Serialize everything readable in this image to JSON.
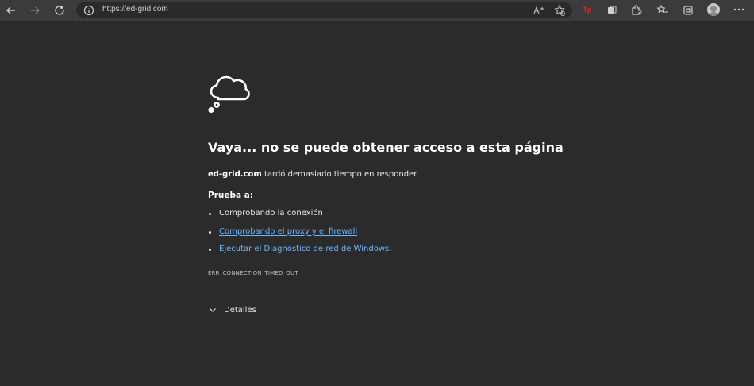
{
  "browser": {
    "url": "https://ed-grid.com",
    "toolbar_icons": [
      "back-icon",
      "forward-icon",
      "refresh-icon",
      "info-icon",
      "read-aloud-icon",
      "favorite-add-icon",
      "extension-tp-icon",
      "collections-icon",
      "extensions-icon",
      "favorites-icon",
      "screenshot-icon",
      "profile-icon",
      "more-menu-icon"
    ],
    "extension_badge": "Tp"
  },
  "error_page": {
    "title": "Vaya... no se puede obtener acceso a esta página",
    "host": "ed-grid.com",
    "desc_rest": " tardó demasiado tiempo en responder",
    "try_label": "Prueba a:",
    "suggestions": [
      {
        "text": "Comprobando la conexión",
        "is_link": false
      },
      {
        "text": "Comprobando el proxy y el firewall",
        "is_link": true
      },
      {
        "text": "Ejecutar el Diagnóstico de red de Windows",
        "is_link": true,
        "suffix": "."
      }
    ],
    "error_code": "ERR_CONNECTION_TIMED_OUT",
    "details_label": "Detalles"
  },
  "colors": {
    "background": "#2b2b2b",
    "toolbar": "#3b3b3b",
    "link": "#6eb4ff",
    "badge": "#e02525"
  }
}
